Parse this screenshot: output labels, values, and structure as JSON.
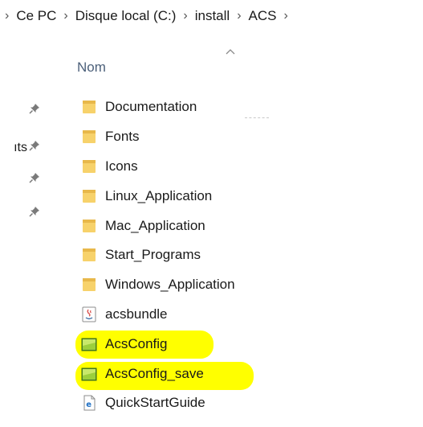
{
  "breadcrumb": {
    "items": [
      {
        "label": "Ce PC"
      },
      {
        "label": "Disque local (C:)"
      },
      {
        "label": "install"
      },
      {
        "label": "ACS"
      }
    ],
    "separator": "›"
  },
  "nav_pane": {
    "partial_label": "ıts",
    "pinned_items_count": 4
  },
  "column_header": {
    "name_label": "Nom",
    "sort": "ascending"
  },
  "files": [
    {
      "name": "Documentation",
      "type": "folder",
      "icon": "folder-icon"
    },
    {
      "name": "Fonts",
      "type": "folder",
      "icon": "folder-icon"
    },
    {
      "name": "Icons",
      "type": "folder",
      "icon": "folder-icon"
    },
    {
      "name": "Linux_Application",
      "type": "folder",
      "icon": "folder-icon"
    },
    {
      "name": "Mac_Application",
      "type": "folder",
      "icon": "folder-icon"
    },
    {
      "name": "Start_Programs",
      "type": "folder",
      "icon": "folder-icon"
    },
    {
      "name": "Windows_Application",
      "type": "folder",
      "icon": "folder-icon"
    },
    {
      "name": "acsbundle",
      "type": "java-archive",
      "icon": "java-archive-icon"
    },
    {
      "name": "AcsConfig",
      "type": "config-file",
      "icon": "config-file-icon",
      "highlighted": true
    },
    {
      "name": "AcsConfig_save",
      "type": "config-file",
      "icon": "config-file-icon",
      "highlighted": true
    },
    {
      "name": "QuickStartGuide",
      "type": "html-document",
      "icon": "html-document-icon"
    }
  ],
  "colors": {
    "highlight": "#ffff00",
    "folder": "#f7d26b",
    "header_text": "#4c607a"
  }
}
